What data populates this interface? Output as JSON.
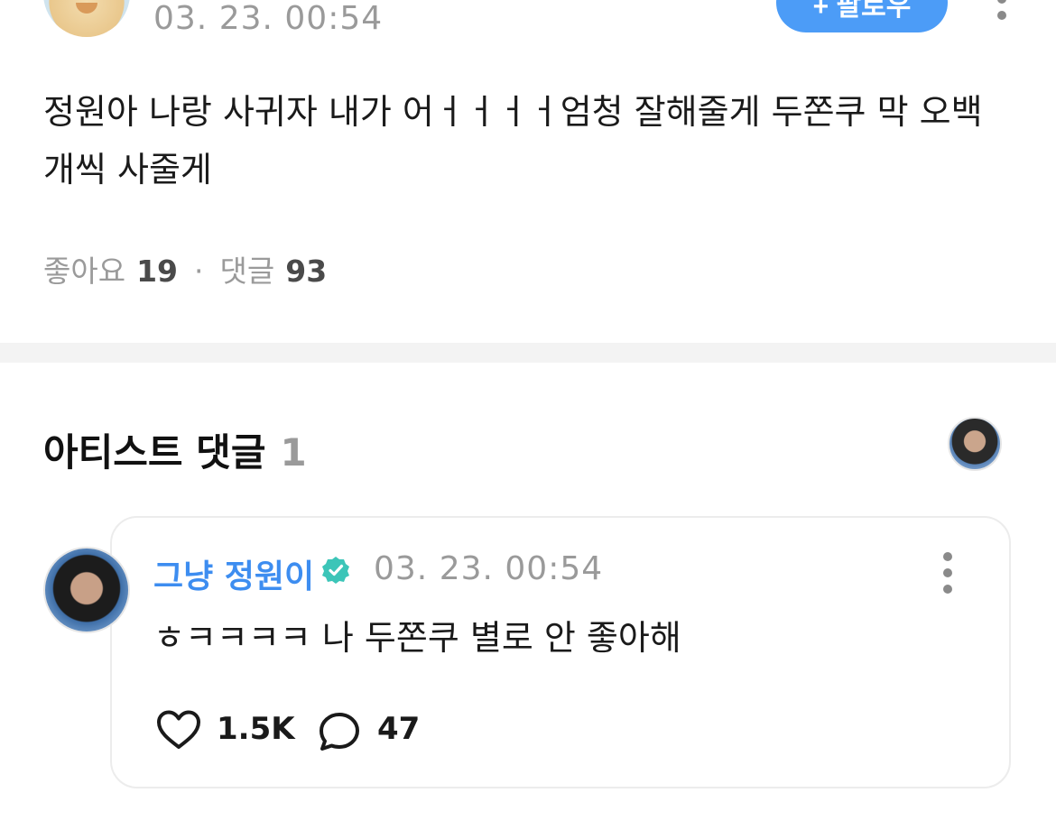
{
  "post": {
    "timestamp": "03. 23. 00:54",
    "follow_label": "+ 팔로우",
    "body": "정원아 나랑 사귀자 내가 어ㅓㅓㅓㅓ엄청 잘해줄게 두쫀쿠 막 오백 개씩 사줄게",
    "stats": {
      "likes_label": "좋아요",
      "likes_count": "19",
      "separator": "·",
      "comments_label": "댓글",
      "comments_count": "93"
    }
  },
  "artist_comments": {
    "title": "아티스트 댓글",
    "count": "1",
    "comment": {
      "author": "그냥 정원이",
      "timestamp": "03. 23. 00:54",
      "text": "ㅎㅋㅋㅋㅋ 나 두쫀쿠 별로 안 좋아해",
      "likes": "1.5K",
      "replies": "47"
    }
  },
  "colors": {
    "accent_blue": "#4c9cf7",
    "author_blue": "#3d8df0",
    "verified_teal": "#3cc5b8",
    "muted_gray": "#9a9a9a"
  },
  "icons": {
    "post_menu": "kebab-vertical-icon",
    "verified": "verified-badge-icon",
    "like": "heart-outline-icon",
    "reply": "speech-bubble-icon"
  }
}
